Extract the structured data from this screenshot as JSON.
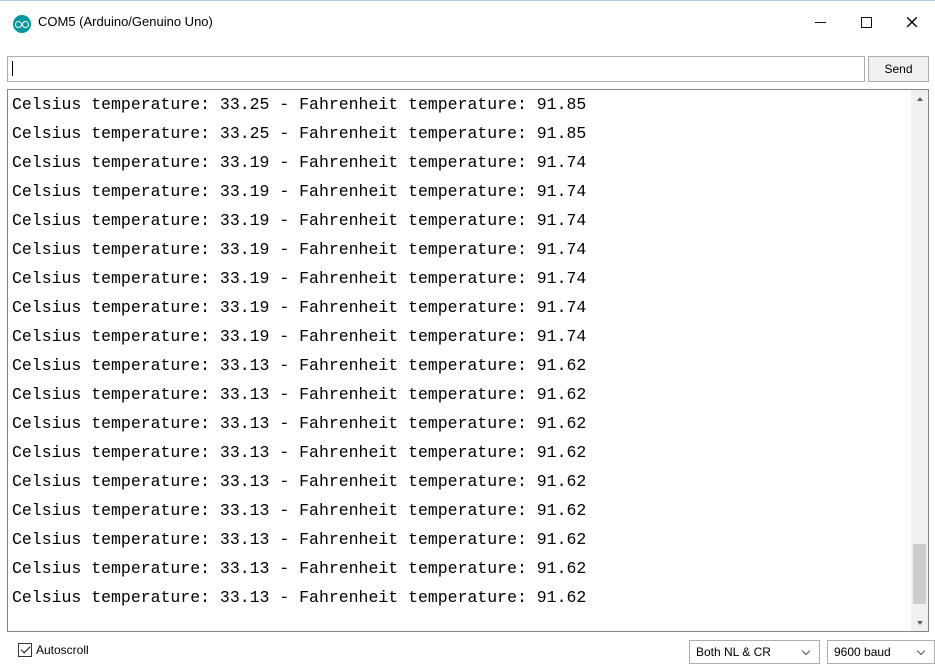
{
  "window": {
    "title": "COM5 (Arduino/Genuino Uno)",
    "icon": "arduino-icon",
    "controls": {
      "minimize": "minimize-icon",
      "maximize": "maximize-icon",
      "close": "close-icon",
      "close_glyph": "×"
    }
  },
  "input": {
    "value": "",
    "placeholder": ""
  },
  "send_button": {
    "label": "Send"
  },
  "output": {
    "lines": [
      "Celsius temperature: 33.25 - Fahrenheit temperature: 91.85",
      "Celsius temperature: 33.25 - Fahrenheit temperature: 91.85",
      "Celsius temperature: 33.19 - Fahrenheit temperature: 91.74",
      "Celsius temperature: 33.19 - Fahrenheit temperature: 91.74",
      "Celsius temperature: 33.19 - Fahrenheit temperature: 91.74",
      "Celsius temperature: 33.19 - Fahrenheit temperature: 91.74",
      "Celsius temperature: 33.19 - Fahrenheit temperature: 91.74",
      "Celsius temperature: 33.19 - Fahrenheit temperature: 91.74",
      "Celsius temperature: 33.19 - Fahrenheit temperature: 91.74",
      "Celsius temperature: 33.13 - Fahrenheit temperature: 91.62",
      "Celsius temperature: 33.13 - Fahrenheit temperature: 91.62",
      "Celsius temperature: 33.13 - Fahrenheit temperature: 91.62",
      "Celsius temperature: 33.13 - Fahrenheit temperature: 91.62",
      "Celsius temperature: 33.13 - Fahrenheit temperature: 91.62",
      "Celsius temperature: 33.13 - Fahrenheit temperature: 91.62",
      "Celsius temperature: 33.13 - Fahrenheit temperature: 91.62",
      "Celsius temperature: 33.13 - Fahrenheit temperature: 91.62",
      "Celsius temperature: 33.13 - Fahrenheit temperature: 91.62"
    ]
  },
  "footer": {
    "autoscroll_label": "Autoscroll",
    "autoscroll_checked": true,
    "line_ending": "Both NL & CR",
    "baud_rate": "9600 baud"
  },
  "colors": {
    "app_icon": "#00979c",
    "title_border": "#a9c9e8"
  }
}
